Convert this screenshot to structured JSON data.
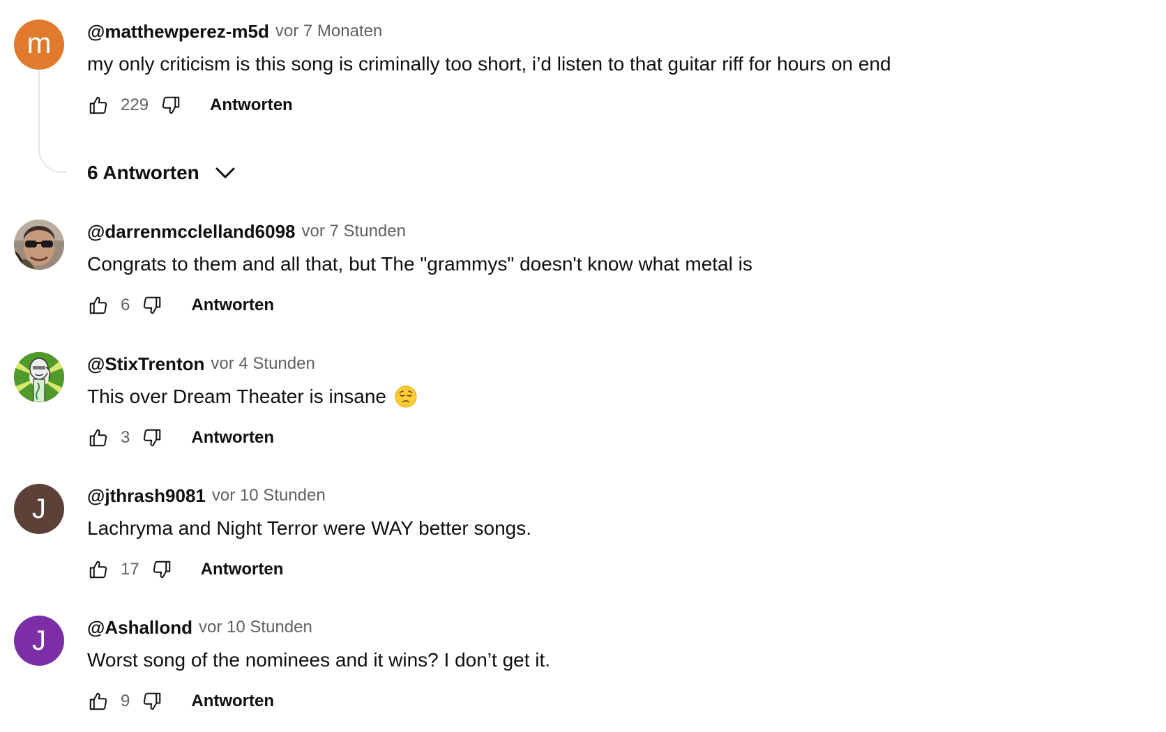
{
  "colors": {
    "avatar_m": "#e07a2c",
    "avatar_j_brown": "#5d4037",
    "avatar_j_purple": "#7b2ea6",
    "secondary_text": "#606060",
    "primary_text": "#0f0f0f"
  },
  "comments": [
    {
      "author": "@matthewperez-m5d",
      "time": "vor 7 Monaten",
      "text": "my only criticism is this song is criminally too short, i’d listen to that guitar riff for hours on end",
      "likes": "229",
      "reply_label": "Antworten",
      "avatar": {
        "type": "letter",
        "letter": "m"
      },
      "replies_label": "6 Antworten"
    },
    {
      "author": "@darrenmcclelland6098",
      "time": "vor 7 Stunden",
      "text": "Congrats to them and all that, but The \"grammys\" doesn't know what metal is",
      "likes": "6",
      "reply_label": "Antworten",
      "avatar": {
        "type": "photo",
        "icon": "person-sunglasses-photo"
      }
    },
    {
      "author": "@StixTrenton",
      "time": "vor 4 Stunden",
      "text": "This over Dream Theater is insane",
      "emoji": "pensive-face-emoji",
      "likes": "3",
      "reply_label": "Antworten",
      "avatar": {
        "type": "illustration",
        "icon": "cartoon-character-green-avatar"
      }
    },
    {
      "author": "@jthrash9081",
      "time": "vor 10 Stunden",
      "text": "Lachryma and Night Terror were WAY better songs.",
      "likes": "17",
      "reply_label": "Antworten",
      "avatar": {
        "type": "letter",
        "letter": "J"
      }
    },
    {
      "author": "@Ashallond",
      "time": "vor 10 Stunden",
      "text": "Worst song of the nominees and it wins? I don’t get it.",
      "likes": "9",
      "reply_label": "Antworten",
      "avatar": {
        "type": "letter",
        "letter": "J"
      }
    }
  ]
}
